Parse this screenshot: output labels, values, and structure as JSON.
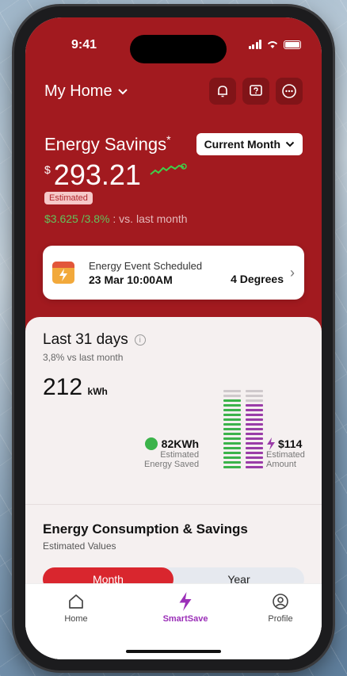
{
  "status_bar": {
    "time": "9:41"
  },
  "header": {
    "home_label": "My Home",
    "icons": [
      "bell-icon",
      "help-icon",
      "more-icon"
    ]
  },
  "savings": {
    "title": "Energy Savings",
    "title_mark": "*",
    "period_select": "Current Month",
    "currency": "$",
    "amount": "293.21",
    "badge": "Estimated",
    "change_value": "$3.625 /3.8%",
    "change_suffix": ": vs. last month",
    "trend_color": "#3fcf4a"
  },
  "event": {
    "title": "Energy Event Scheduled",
    "date": "23 Mar 10:00AM",
    "degrees": "4 Degrees"
  },
  "usage": {
    "title": "Last 31 days",
    "vs_text": "3,8% vs last month",
    "kwh_value": "212",
    "kwh_unit": "kWh",
    "saved_value": "82KWh",
    "saved_label_1": "Estimated",
    "saved_label_2": "Energy Saved",
    "amount_value": "$114",
    "amount_label_1": "Estimated",
    "amount_label_2": "Amount",
    "bar_colors": {
      "green": "#3bb34a",
      "purple": "#9a3ca8",
      "grey": "#cfc9cc"
    }
  },
  "consumption": {
    "title": "Energy Consumption & Savings",
    "subtitle": "Estimated Values",
    "tabs": [
      "Month",
      "Year"
    ],
    "active_tab": "Month"
  },
  "tabbar": {
    "items": [
      {
        "label": "Home",
        "icon": "home-icon"
      },
      {
        "label": "SmartSave",
        "icon": "bolt-icon"
      },
      {
        "label": "Profile",
        "icon": "profile-icon"
      }
    ],
    "active": "SmartSave"
  },
  "colors": {
    "brand_red": "#a21a1f",
    "accent_red": "#d9262e",
    "accent_purple": "#9b2fb8"
  }
}
